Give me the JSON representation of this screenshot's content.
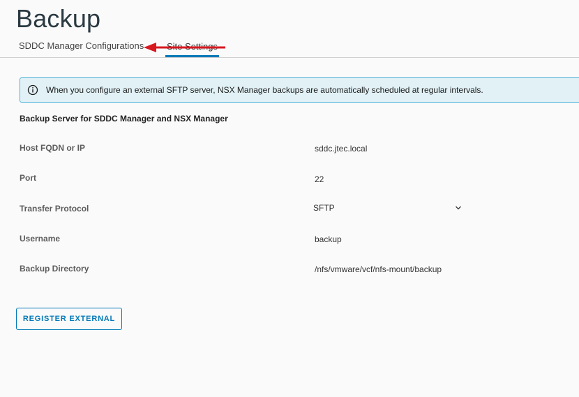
{
  "page": {
    "title": "Backup"
  },
  "tabs": [
    {
      "label": "SDDC Manager Configurations",
      "active": false
    },
    {
      "label": "Site Settings",
      "active": true
    }
  ],
  "alert": {
    "icon": "info-icon",
    "text": "When you configure an external SFTP server, NSX Manager backups are automatically scheduled at regular intervals."
  },
  "section": {
    "heading": "Backup Server for SDDC Manager and NSX Manager"
  },
  "fields": {
    "host": {
      "label": "Host FQDN or IP",
      "value": "sddc.jtec.local"
    },
    "port": {
      "label": "Port",
      "value": "22"
    },
    "protocol": {
      "label": "Transfer Protocol",
      "value": "SFTP"
    },
    "username": {
      "label": "Username",
      "value": "backup"
    },
    "directory": {
      "label": "Backup Directory",
      "value": "/nfs/vmware/vcf/nfs-mount/backup"
    }
  },
  "actions": {
    "register_label": "REGISTER EXTERNAL"
  },
  "colors": {
    "accent": "#0079b8",
    "alert_bg": "#e1f1f6",
    "alert_border": "#49afd9",
    "annotation_arrow": "#d71920"
  }
}
